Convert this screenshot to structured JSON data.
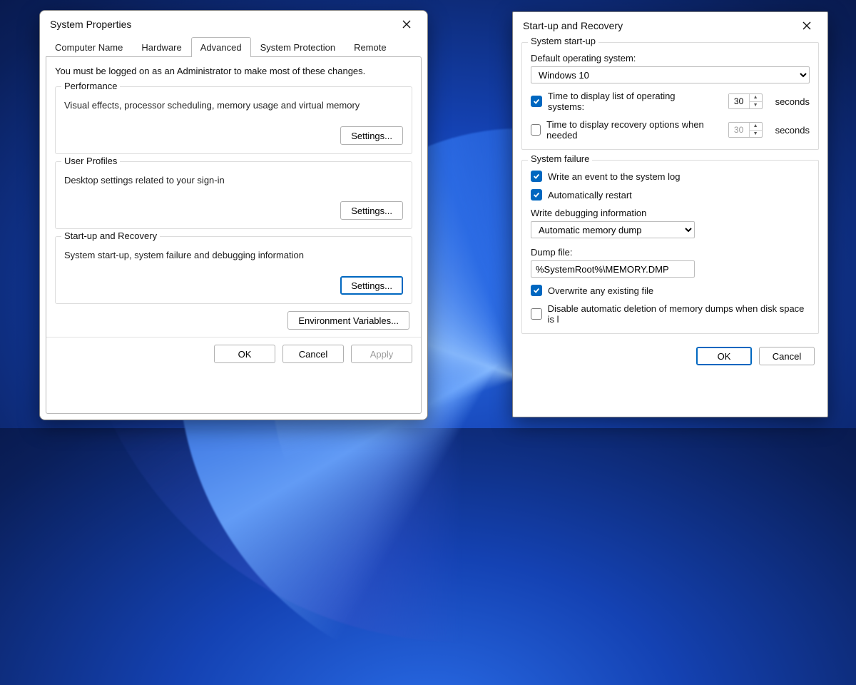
{
  "sysprops": {
    "title": "System Properties",
    "tabs": [
      "Computer Name",
      "Hardware",
      "Advanced",
      "System Protection",
      "Remote"
    ],
    "active_tab_index": 2,
    "admin_line": "You must be logged on as an Administrator to make most of these changes.",
    "groups": {
      "performance": {
        "legend": "Performance",
        "desc": "Visual effects, processor scheduling, memory usage and virtual memory",
        "button": "Settings..."
      },
      "userprofiles": {
        "legend": "User Profiles",
        "desc": "Desktop settings related to your sign-in",
        "button": "Settings..."
      },
      "startup": {
        "legend": "Start-up and Recovery",
        "desc": "System start-up, system failure and debugging information",
        "button": "Settings..."
      }
    },
    "env_button": "Environment Variables...",
    "footer": {
      "ok": "OK",
      "cancel": "Cancel",
      "apply": "Apply"
    }
  },
  "startup_recovery": {
    "title": "Start-up and Recovery",
    "system_startup": {
      "legend": "System start-up",
      "default_os_label": "Default operating system:",
      "default_os_value": "Windows 10",
      "time_list": {
        "checked": true,
        "label": "Time to display list of operating systems:",
        "value": "30",
        "unit": "seconds"
      },
      "time_recovery": {
        "checked": false,
        "label": "Time to display recovery options when needed",
        "value": "30",
        "unit": "seconds"
      }
    },
    "system_failure": {
      "legend": "System failure",
      "write_event": {
        "checked": true,
        "label": "Write an event to the system log"
      },
      "auto_restart": {
        "checked": true,
        "label": "Automatically restart"
      },
      "write_debug_label": "Write debugging information",
      "write_debug_value": "Automatic memory dump",
      "dump_file_label": "Dump file:",
      "dump_file_value": "%SystemRoot%\\MEMORY.DMP",
      "overwrite": {
        "checked": true,
        "label": "Overwrite any existing file"
      },
      "disable_auto_delete": {
        "checked": false,
        "label": "Disable automatic deletion of memory dumps when disk space is l"
      }
    },
    "footer": {
      "ok": "OK",
      "cancel": "Cancel"
    }
  }
}
